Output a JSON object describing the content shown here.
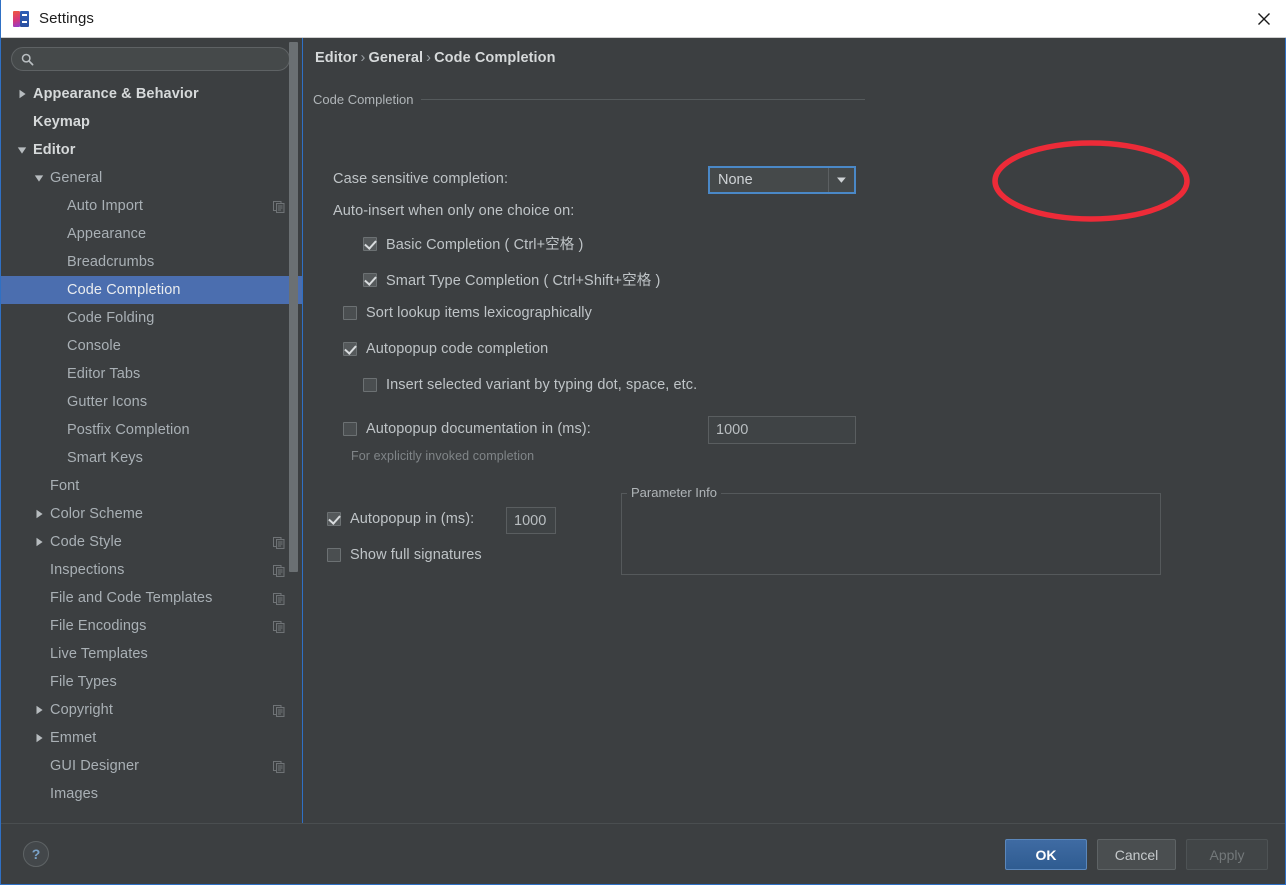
{
  "window": {
    "title": "Settings",
    "icon": "intellij-logo-icon",
    "close_label": "✕"
  },
  "sidebar": {
    "search": {
      "value": "",
      "placeholder": "",
      "icon": "search-icon"
    },
    "items": [
      {
        "label": "Appearance & Behavior",
        "level": 0,
        "twisty": "collapsed",
        "top": true,
        "selected": false,
        "mod_icon": false
      },
      {
        "label": "Keymap",
        "level": 0,
        "twisty": "none",
        "top": true,
        "selected": false,
        "mod_icon": false
      },
      {
        "label": "Editor",
        "level": 0,
        "twisty": "expanded",
        "top": true,
        "selected": false,
        "mod_icon": false
      },
      {
        "label": "General",
        "level": 1,
        "twisty": "expanded",
        "top": false,
        "selected": false,
        "mod_icon": false
      },
      {
        "label": "Auto Import",
        "level": 2,
        "twisty": "none",
        "top": false,
        "selected": false,
        "mod_icon": true
      },
      {
        "label": "Appearance",
        "level": 2,
        "twisty": "none",
        "top": false,
        "selected": false,
        "mod_icon": false
      },
      {
        "label": "Breadcrumbs",
        "level": 2,
        "twisty": "none",
        "top": false,
        "selected": false,
        "mod_icon": false
      },
      {
        "label": "Code Completion",
        "level": 2,
        "twisty": "none",
        "top": false,
        "selected": true,
        "mod_icon": false
      },
      {
        "label": "Code Folding",
        "level": 2,
        "twisty": "none",
        "top": false,
        "selected": false,
        "mod_icon": false
      },
      {
        "label": "Console",
        "level": 2,
        "twisty": "none",
        "top": false,
        "selected": false,
        "mod_icon": false
      },
      {
        "label": "Editor Tabs",
        "level": 2,
        "twisty": "none",
        "top": false,
        "selected": false,
        "mod_icon": false
      },
      {
        "label": "Gutter Icons",
        "level": 2,
        "twisty": "none",
        "top": false,
        "selected": false,
        "mod_icon": false
      },
      {
        "label": "Postfix Completion",
        "level": 2,
        "twisty": "none",
        "top": false,
        "selected": false,
        "mod_icon": false
      },
      {
        "label": "Smart Keys",
        "level": 2,
        "twisty": "none",
        "top": false,
        "selected": false,
        "mod_icon": false
      },
      {
        "label": "Font",
        "level": 1,
        "twisty": "none",
        "top": false,
        "selected": false,
        "mod_icon": false
      },
      {
        "label": "Color Scheme",
        "level": 1,
        "twisty": "collapsed",
        "top": false,
        "selected": false,
        "mod_icon": false
      },
      {
        "label": "Code Style",
        "level": 1,
        "twisty": "collapsed",
        "top": false,
        "selected": false,
        "mod_icon": true
      },
      {
        "label": "Inspections",
        "level": 1,
        "twisty": "none",
        "top": false,
        "selected": false,
        "mod_icon": true
      },
      {
        "label": "File and Code Templates",
        "level": 1,
        "twisty": "none",
        "top": false,
        "selected": false,
        "mod_icon": true
      },
      {
        "label": "File Encodings",
        "level": 1,
        "twisty": "none",
        "top": false,
        "selected": false,
        "mod_icon": true
      },
      {
        "label": "Live Templates",
        "level": 1,
        "twisty": "none",
        "top": false,
        "selected": false,
        "mod_icon": false
      },
      {
        "label": "File Types",
        "level": 1,
        "twisty": "none",
        "top": false,
        "selected": false,
        "mod_icon": false
      },
      {
        "label": "Copyright",
        "level": 1,
        "twisty": "collapsed",
        "top": false,
        "selected": false,
        "mod_icon": true
      },
      {
        "label": "Emmet",
        "level": 1,
        "twisty": "collapsed",
        "top": false,
        "selected": false,
        "mod_icon": false
      },
      {
        "label": "GUI Designer",
        "level": 1,
        "twisty": "none",
        "top": false,
        "selected": false,
        "mod_icon": true
      },
      {
        "label": "Images",
        "level": 1,
        "twisty": "none",
        "top": false,
        "selected": false,
        "mod_icon": false
      }
    ]
  },
  "main": {
    "breadcrumb": {
      "part1": "Editor",
      "part2": "General",
      "part3": "Code Completion",
      "separator": "›"
    },
    "group_title": "Code Completion",
    "case_sensitive": {
      "label": "Case sensitive completion:",
      "value": "None",
      "arrow_icon": "chevron-down-icon"
    },
    "auto_insert_label": "Auto-insert when only one choice on:",
    "checkboxes": [
      {
        "label": "Basic Completion ( Ctrl+空格 )",
        "checked": true,
        "indent": 2
      },
      {
        "label": "Smart Type Completion ( Ctrl+Shift+空格 )",
        "checked": true,
        "indent": 2
      },
      {
        "label": "Sort lookup items lexicographically",
        "checked": false,
        "indent": 1
      },
      {
        "label": "Autopopup code completion",
        "checked": true,
        "indent": 1
      },
      {
        "label": "Insert selected variant by typing dot, space, etc.",
        "checked": false,
        "indent": 2
      }
    ],
    "autopopup_doc": {
      "label": "Autopopup documentation in (ms):",
      "checked": false,
      "value": "1000",
      "hint": "For explicitly invoked completion"
    },
    "parameter_info": {
      "legend": "Parameter Info",
      "autopopup": {
        "label": "Autopopup in (ms):",
        "checked": true,
        "value": "1000"
      },
      "show_signatures": {
        "label": "Show full signatures",
        "checked": false
      }
    },
    "annotation": {
      "shape": "red-ellipse-highlight",
      "color": "#ed2b38"
    }
  },
  "footer": {
    "help_label": "?",
    "ok_label": "OK",
    "cancel_label": "Cancel",
    "apply_label": "Apply"
  }
}
